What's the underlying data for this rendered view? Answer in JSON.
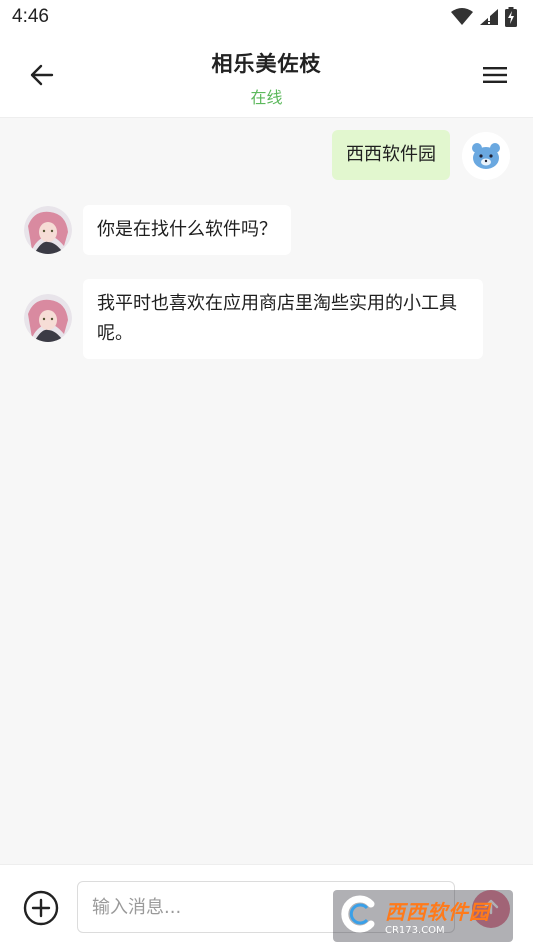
{
  "status_bar": {
    "time": "4:46",
    "icons": [
      "wifi-icon",
      "signal-icon",
      "battery-icon"
    ]
  },
  "header": {
    "back_icon": "arrow-left-icon",
    "title": "相乐美佐枝",
    "status": "在线",
    "menu_icon": "hamburger-menu-icon",
    "status_color": "#5cb85c"
  },
  "messages": [
    {
      "sender": "me",
      "text": "西西软件园",
      "avatar": "bear-avatar"
    },
    {
      "sender": "other",
      "text": "你是在找什么软件吗？",
      "avatar": "character-avatar"
    },
    {
      "sender": "other",
      "text": "我平时也喜欢在应用商店里淘些实用的小工具呢。",
      "avatar": "character-avatar"
    }
  ],
  "input_bar": {
    "add_icon": "plus-circle-icon",
    "placeholder": "输入消息...",
    "send_icon": "send-icon"
  },
  "watermark": {
    "main": "西西软件园",
    "sub": "CR173.COM"
  },
  "colors": {
    "my_bubble": "#e2f7cf",
    "other_bubble": "#ffffff",
    "background": "#f7f7f7"
  }
}
